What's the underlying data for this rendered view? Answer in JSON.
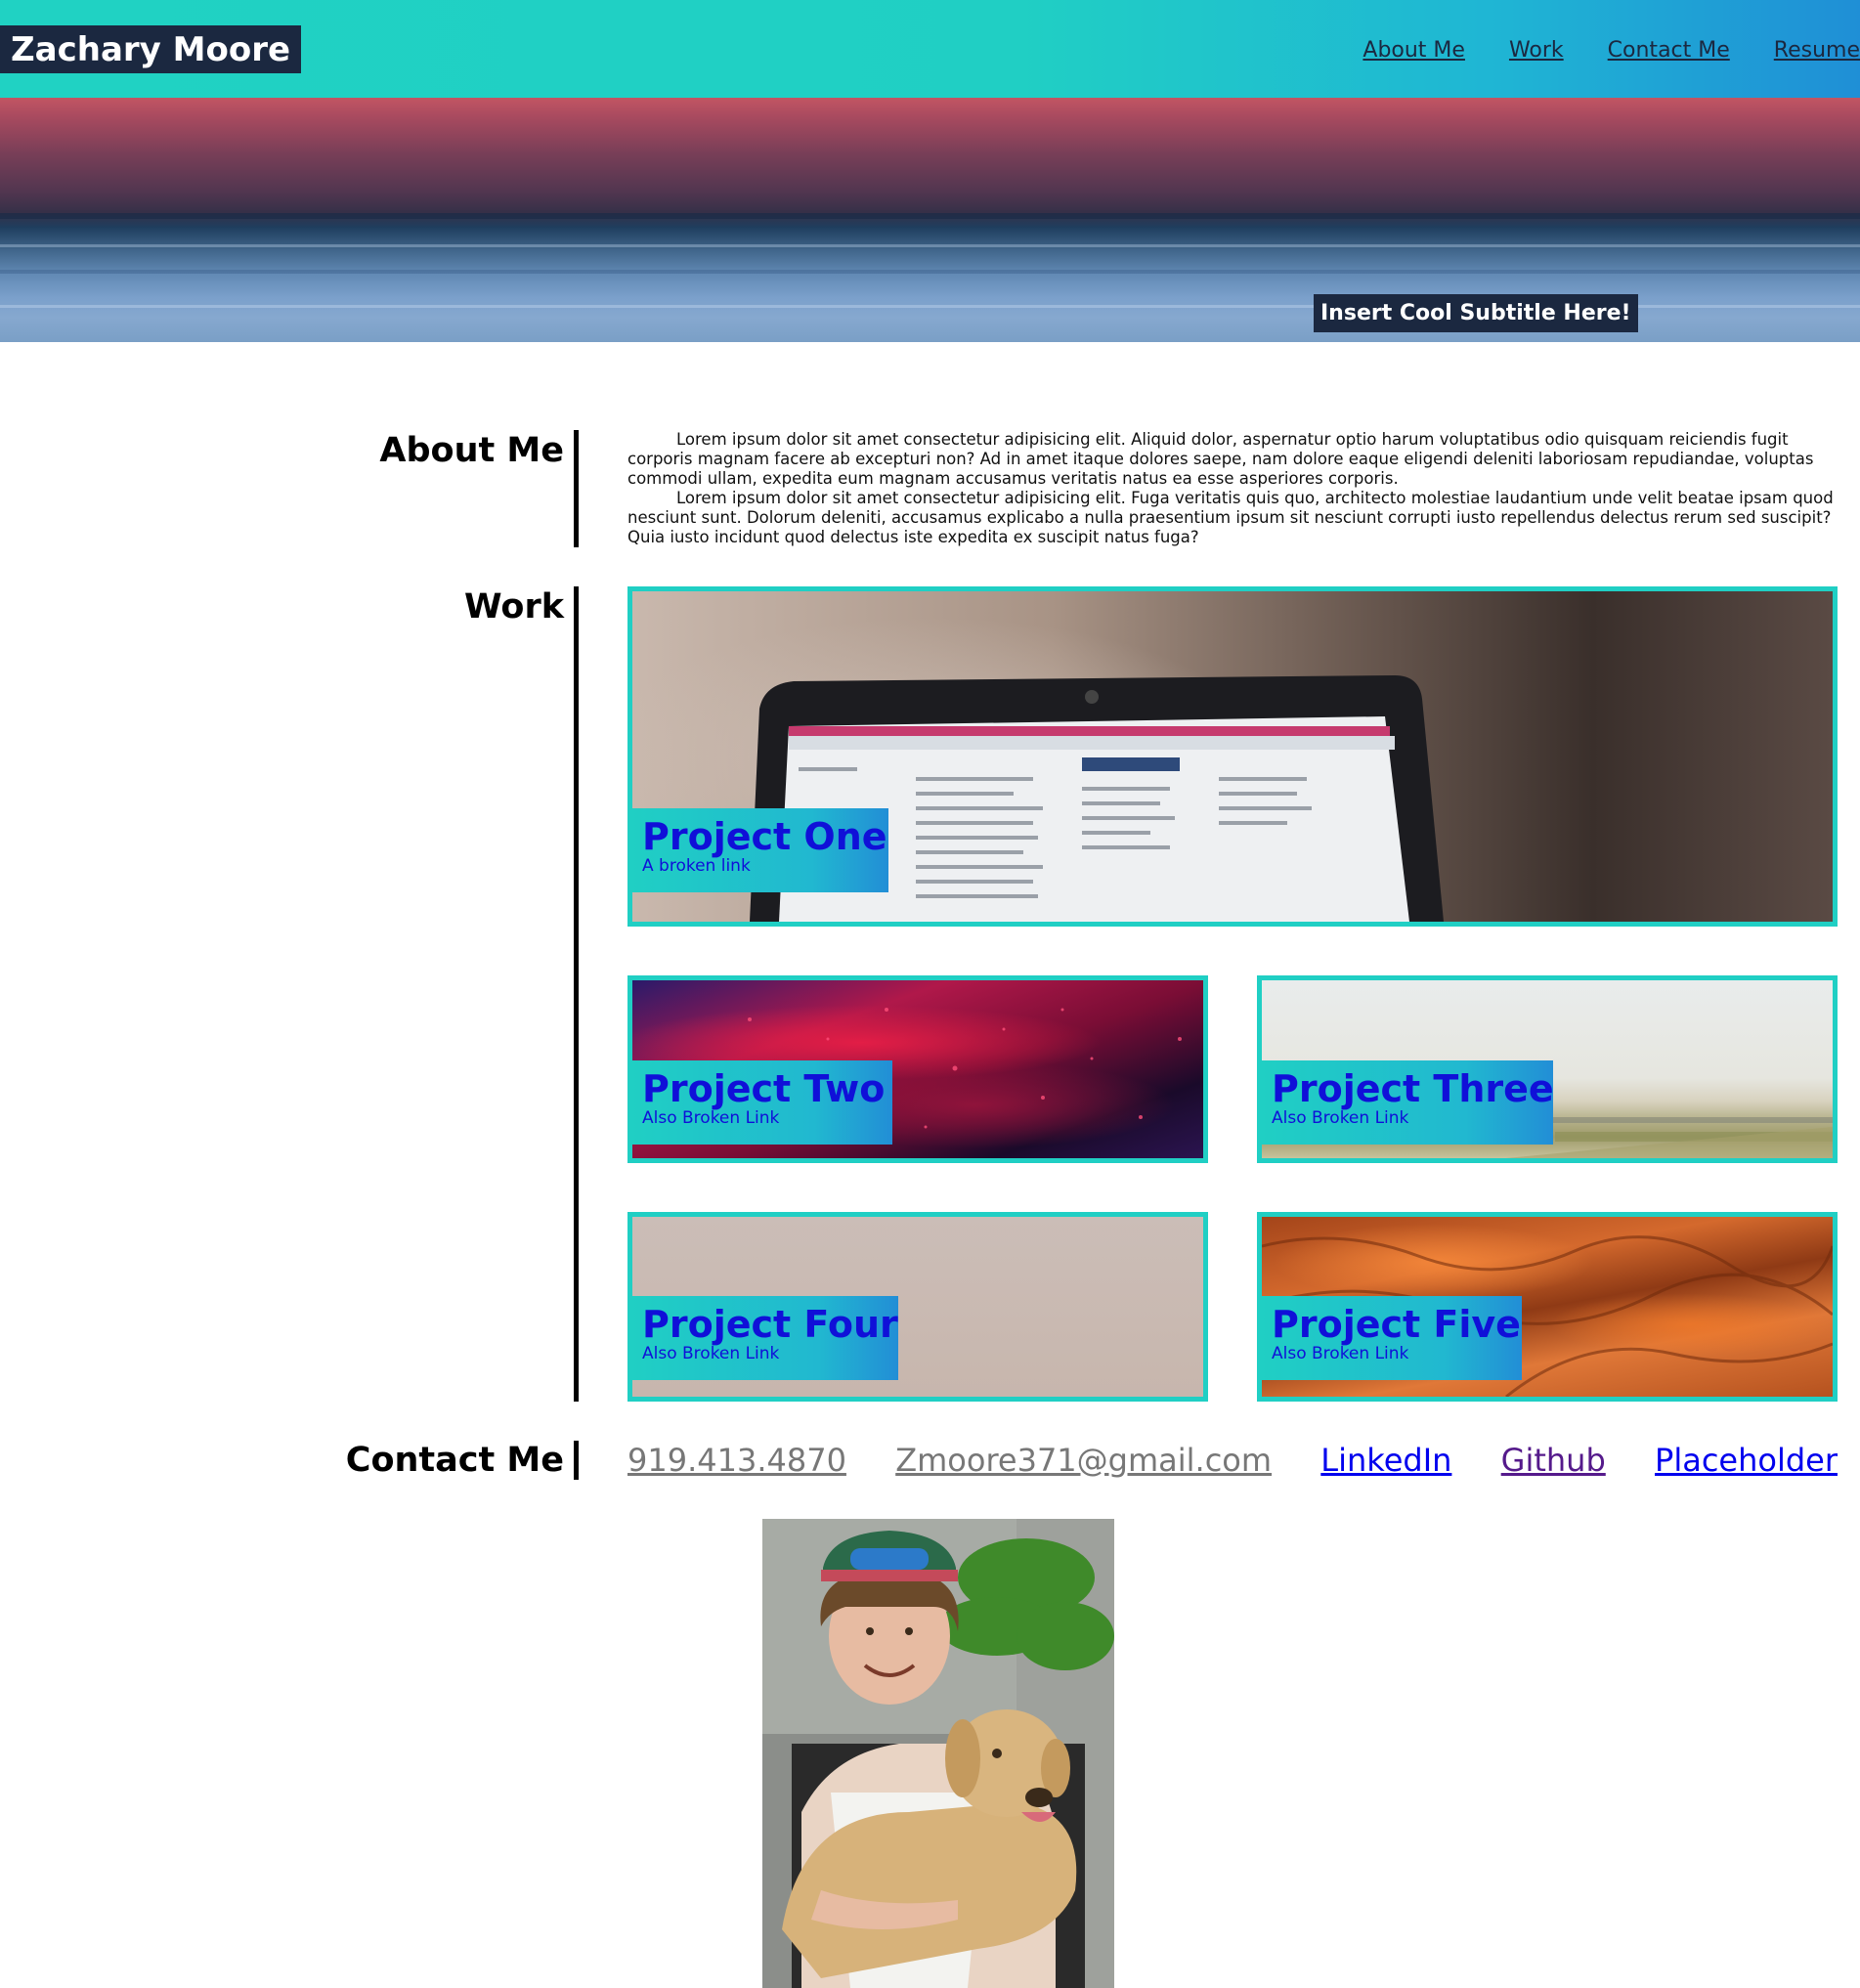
{
  "header": {
    "brand": "Zachary Moore",
    "nav": [
      "About Me",
      "Work",
      "Contact Me",
      "Resume"
    ]
  },
  "hero": {
    "subtitle": "Insert Cool Subtitle Here!"
  },
  "about": {
    "title": "About Me",
    "paragraphs": [
      "Lorem ipsum dolor sit amet consectetur adipisicing elit. Aliquid dolor, aspernatur optio harum voluptatibus odio quisquam reiciendis fugit corporis magnam facere ab excepturi non? Ad in amet itaque dolores saepe, nam dolore eaque eligendi deleniti laboriosam repudiandae, voluptas commodi ullam, expedita eum magnam accusamus veritatis natus ea esse asperiores corporis.",
      "Lorem ipsum dolor sit amet consectetur adipisicing elit. Fuga veritatis quis quo, architecto molestiae laudantium unde velit beatae ipsam quod nesciunt sunt. Dolorum deleniti, accusamus explicabo a nulla praesentium ipsum sit nesciunt corrupti iusto repellendus delectus rerum sed suscipit? Quia iusto incidunt quod delectus iste expedita ex suscipit natus fuga?"
    ]
  },
  "work": {
    "title": "Work",
    "projects": [
      {
        "title": "Project One",
        "subtitle": "A broken link",
        "image": "laptop-photo"
      },
      {
        "title": "Project Two",
        "subtitle": "Also Broken Link",
        "image": "abstract-red-photo"
      },
      {
        "title": "Project Three",
        "subtitle": "Also Broken Link",
        "image": "landscape-photo"
      },
      {
        "title": "Project Four",
        "subtitle": "Also Broken Link",
        "image": "plain-wall-photo"
      },
      {
        "title": "Project Five",
        "subtitle": "Also Broken Link",
        "image": "desert-dunes-photo"
      }
    ]
  },
  "contact": {
    "title": "Contact Me",
    "links": [
      {
        "label": "919.413.4870",
        "color": "#777777"
      },
      {
        "label": "Zmoore371@gmail.com",
        "color": "#777777"
      },
      {
        "label": "LinkedIn",
        "color": "#0000ee"
      },
      {
        "label": "Github",
        "color": "#551a8b"
      },
      {
        "label": "Placeholder",
        "color": "#0000ee"
      }
    ]
  },
  "colors": {
    "header_teal": "#20d2c3",
    "header_blue": "#1f8fd6",
    "dark_navy": "#1b2840",
    "card_border": "#20cfc4",
    "project_title": "#1010d8"
  }
}
